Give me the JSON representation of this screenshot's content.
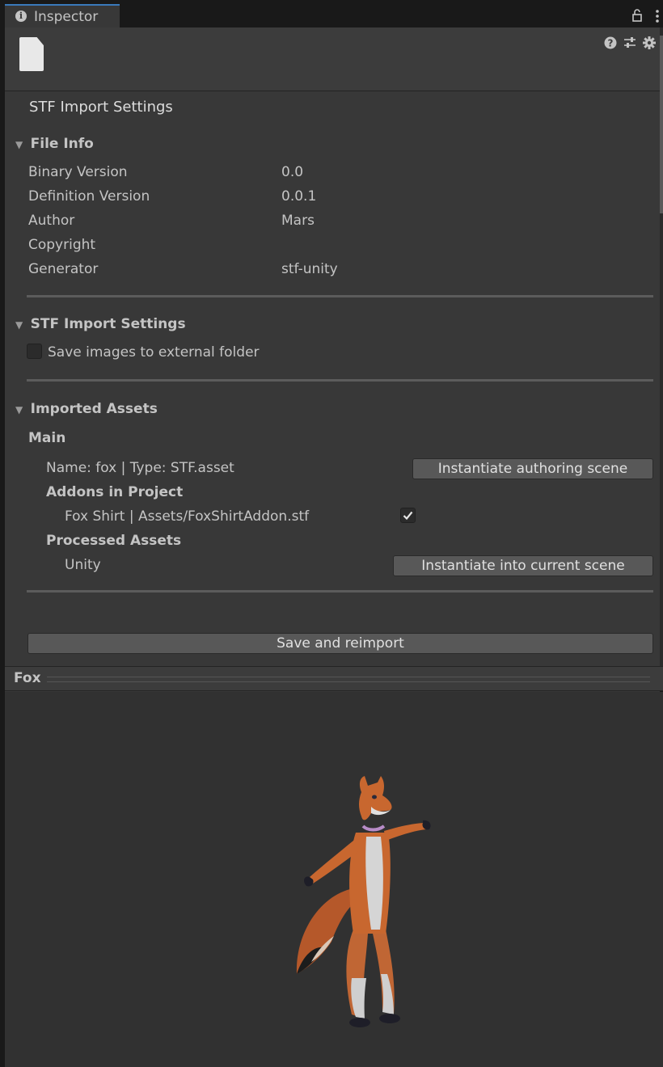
{
  "tab": {
    "label": "Inspector",
    "info_icon": "info-icon"
  },
  "header_icons": [
    "lock-icon",
    "kebab-menu-icon",
    "help-icon",
    "preset-icon",
    "gear-icon"
  ],
  "title": "STF Import Settings",
  "file_info": {
    "heading": "File Info",
    "rows": [
      {
        "label": "Binary Version",
        "value": "0.0"
      },
      {
        "label": "Definition Version",
        "value": "0.0.1"
      },
      {
        "label": "Author",
        "value": "Mars"
      },
      {
        "label": "Copyright",
        "value": ""
      },
      {
        "label": "Generator",
        "value": "stf-unity"
      }
    ]
  },
  "import_settings": {
    "heading": "STF Import Settings",
    "save_images_label": "Save images to external folder",
    "save_images_checked": false
  },
  "imported_assets": {
    "heading": "Imported Assets",
    "main_label": "Main",
    "main_asset": "Name: fox | Type: STF.asset",
    "instantiate_authoring_label": "Instantiate authoring scene",
    "addons_label": "Addons in Project",
    "addon_item": "Fox Shirt | Assets/FoxShirtAddon.stf",
    "addon_checked": true,
    "processed_label": "Processed Assets",
    "processed_item": "Unity",
    "instantiate_current_label": "Instantiate into current scene"
  },
  "save_reimport_label": "Save and reimport",
  "preview": {
    "title": "Fox"
  },
  "colors": {
    "panel": "#383838",
    "tab_accent": "#3a79bb",
    "button": "#585858",
    "background": "#191919"
  }
}
